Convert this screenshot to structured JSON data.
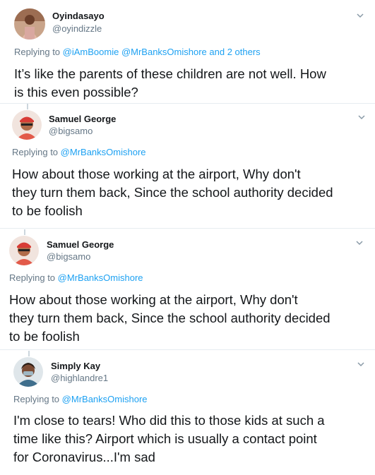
{
  "tweets": [
    {
      "name": "Oyindasayo",
      "handle": "@oyindizzle",
      "replying_prefix": "Replying to",
      "replying_mentions": "@iAmBoomie @MrBanksOmishore",
      "replying_suffix": " and 2 others",
      "lines": [
        "It’s like the parents of these children are not well. How",
        "is this even possible?"
      ],
      "avatar_icon": "user-photo-avatar"
    },
    {
      "name": "Samuel George",
      "handle": "@bigsamo",
      "replying_prefix": "Replying to",
      "replying_mentions": "@MrBanksOmishore",
      "replying_suffix": "",
      "lines": [
        "How about those working at the airport, Why don't",
        "they turn them back, Since the school authority decided",
        "to be foolish"
      ],
      "avatar_icon": "user-photo-avatar"
    },
    {
      "name": "Samuel George",
      "handle": "@bigsamo",
      "replying_prefix": "Replying to",
      "replying_mentions": "@MrBanksOmishore",
      "replying_suffix": "",
      "lines": [
        "How about those working at the airport, Why don't",
        "they turn them back, Since the school authority decided",
        "to be foolish"
      ],
      "avatar_icon": "user-photo-avatar"
    },
    {
      "name": "Simply Kay",
      "handle": "@highlandre1",
      "replying_prefix": "Replying to",
      "replying_mentions": "@MrBanksOmishore",
      "replying_suffix": "",
      "lines": [
        "I'm close to tears! Who did this to those kids at such a",
        "time like this? Airport which is usually a contact point",
        "for Coronavirus...I'm sad"
      ],
      "avatar_icon": "user-photo-avatar"
    }
  ],
  "colors": {
    "link": "#1da1f2",
    "secondary_text": "#657786",
    "primary_text": "#14171a",
    "divider": "#e6ecf0"
  },
  "icons": {
    "menu": "chevron-down-icon"
  }
}
